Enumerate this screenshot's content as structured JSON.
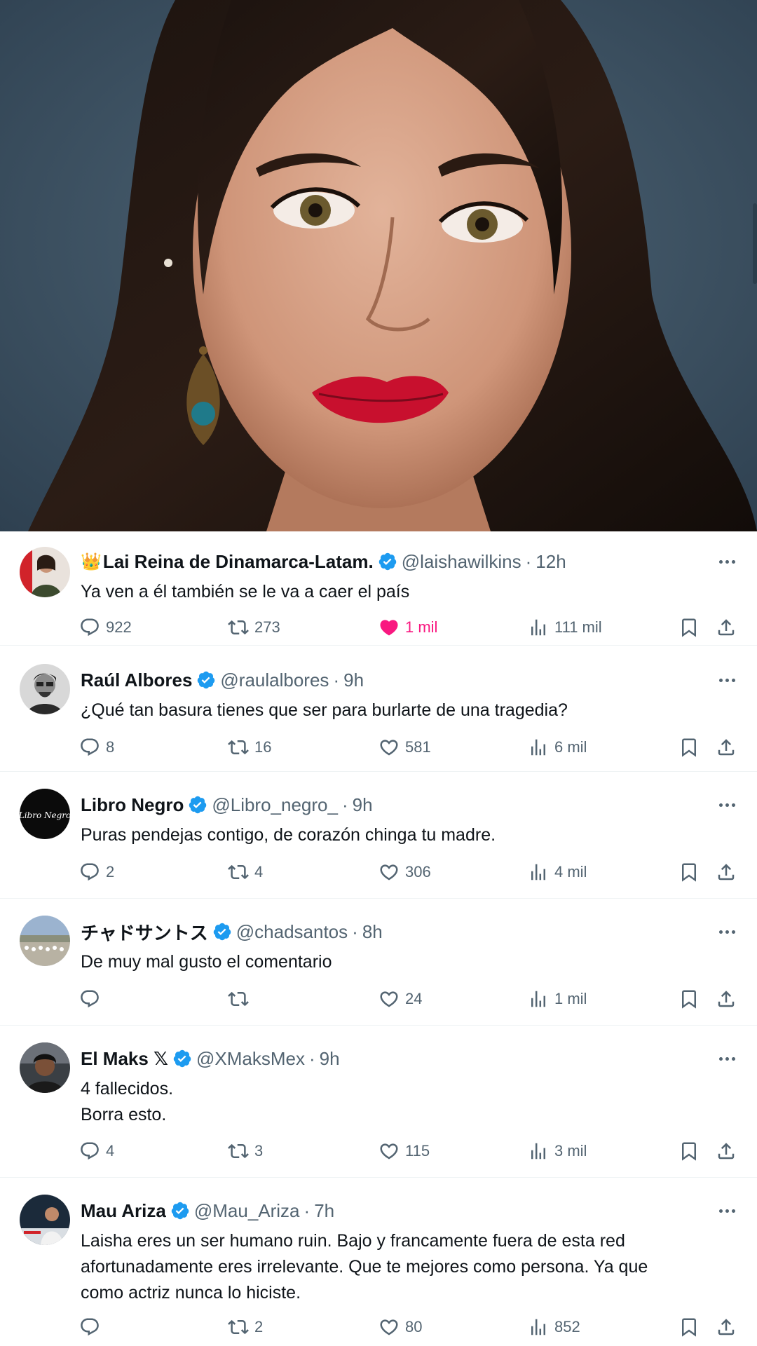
{
  "replies": [
    {
      "name": "Lai Reina de Dinamarca-Latam.",
      "name_prefix": "👑",
      "handle": "@laishawilkins",
      "time": "12h",
      "text": "Ya ven a él también se le va a caer el país",
      "replies": "922",
      "retweets": "273",
      "likes": "1 mil",
      "liked": true,
      "views": "111 mil"
    },
    {
      "name": "Raúl Albores",
      "handle": "@raulalbores",
      "time": "9h",
      "text": "¿Qué tan basura tienes que ser para burlarte de una tragedia?",
      "replies": "8",
      "retweets": "16",
      "likes": "581",
      "views": "6 mil"
    },
    {
      "name": "Libro Negro",
      "handle": "@Libro_negro_",
      "time": "9h",
      "text": "Puras pendejas contigo, de corazón chinga tu madre.",
      "replies": "2",
      "retweets": "4",
      "likes": "306",
      "views": "4 mil",
      "avatar_text": "Libro Negro"
    },
    {
      "name": "チャドサントス",
      "handle": "@chadsantos",
      "time": "8h",
      "text": "De muy mal gusto el comentario",
      "replies": "",
      "retweets": "",
      "likes": "24",
      "views": "1 mil"
    },
    {
      "name": "El Maks 𝕏",
      "handle": "@XMaksMex",
      "time": "9h",
      "text_lines": [
        "4 fallecidos.",
        "Borra esto."
      ],
      "replies": "4",
      "retweets": "3",
      "likes": "115",
      "views": "3 mil"
    },
    {
      "name": "Mau Ariza",
      "handle": "@Mau_Ariza",
      "time": "7h",
      "text_lines": [
        "Laisha eres un ser humano ruin. Bajo y francamente fuera de esta red",
        "afortunadamente eres irrelevante. Que te mejores como persona. Ya que",
        "como actriz nunca lo hiciste."
      ],
      "replies": "",
      "retweets": "2",
      "likes": "80",
      "views": "852"
    }
  ],
  "colors": {
    "verified": "#1d9bf0",
    "like_active": "#f91880",
    "secondary_text": "#536471"
  },
  "icons": [
    "reply-icon",
    "retweet-icon",
    "like-icon",
    "views-icon",
    "bookmark-icon",
    "share-icon",
    "verified-badge-icon",
    "more-icon"
  ]
}
